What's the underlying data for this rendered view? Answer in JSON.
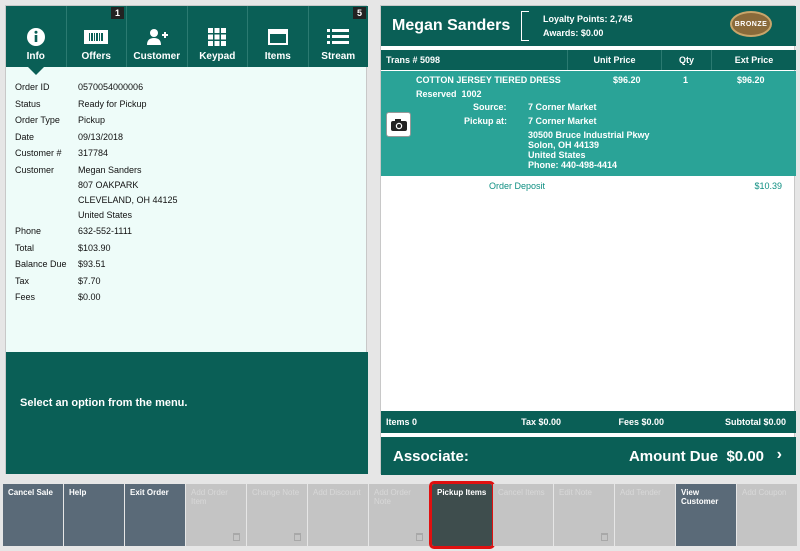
{
  "tabs": [
    {
      "label": "Info",
      "icon": "info-icon",
      "badge": ""
    },
    {
      "label": "Offers",
      "icon": "coupon-icon",
      "badge": "1"
    },
    {
      "label": "Customer",
      "icon": "add-user-icon",
      "badge": ""
    },
    {
      "label": "Keypad",
      "icon": "keypad-icon",
      "badge": ""
    },
    {
      "label": "Items",
      "icon": "items-icon",
      "badge": ""
    },
    {
      "label": "Stream",
      "icon": "stream-icon",
      "badge": "5"
    }
  ],
  "order_info": {
    "order_id_label": "Order ID",
    "order_id": "0570054000006",
    "status_label": "Status",
    "status": "Ready for Pickup",
    "order_type_label": "Order Type",
    "order_type": "Pickup",
    "date_label": "Date",
    "date": "09/13/2018",
    "customer_num_label": "Customer #",
    "customer_num": "317784",
    "customer_label": "Customer",
    "customer_name": "Megan Sanders",
    "address_line1": "807 OAKPARK",
    "address_line2": "CLEVELAND, OH 44125",
    "address_line3": "United States",
    "phone_label": "Phone",
    "phone": "632-552-1111",
    "total_label": "Total",
    "total": "$103.90",
    "balance_label": "Balance Due",
    "balance": "$93.51",
    "tax_label": "Tax",
    "tax": "$7.70",
    "fees_label": "Fees",
    "fees": "$0.00"
  },
  "left_message": "Select an option from the menu.",
  "customer_header": {
    "name": "Megan Sanders",
    "loyalty_points": "Loyalty Points: 2,745",
    "awards": "Awards: $0.00",
    "tier": "BRONZE"
  },
  "columns": {
    "trans": "Trans # 5098",
    "unit": "Unit Price",
    "qty": "Qty",
    "ext": "Ext Price"
  },
  "item": {
    "name": "COTTON JERSEY TIERED DRESS",
    "unit_price": "$96.20",
    "qty": "1",
    "ext_price": "$96.20",
    "reserved": "Reserved  1002",
    "source_label": "Source:",
    "source": "7 Corner Market",
    "pickup_label": "Pickup at:",
    "pickup_name": "7 Corner Market",
    "pickup_addr1": "30500 Bruce Industrial Pkwy",
    "pickup_addr2": "Solon, OH 44139",
    "pickup_addr3": "United States",
    "pickup_phone": "Phone: 440-498-4414"
  },
  "deposit": {
    "label": "Order Deposit",
    "value": "$10.39"
  },
  "totals": {
    "items": "Items 0",
    "tax": "Tax $0.00",
    "fees": "Fees $0.00",
    "subtotal": "Subtotal $0.00"
  },
  "footer": {
    "associate": "Associate:",
    "amount_due": "Amount Due  $0.00"
  },
  "buttons": [
    {
      "label": "Cancel Sale",
      "state": "on"
    },
    {
      "label": "Help",
      "state": "on"
    },
    {
      "label": "Exit Order",
      "state": "on"
    },
    {
      "label": "Add Order Item",
      "state": "off",
      "trash": true
    },
    {
      "label": "Change Note",
      "state": "off",
      "trash": true
    },
    {
      "label": "Add Discount",
      "state": "off",
      "trash": false
    },
    {
      "label": "Add Order Note",
      "state": "off",
      "trash": true
    },
    {
      "label": "Pickup Items",
      "state": "sel",
      "trash": false
    },
    {
      "label": "Cancel Items",
      "state": "off",
      "trash": false
    },
    {
      "label": "Edit Note",
      "state": "off",
      "trash": true
    },
    {
      "label": "Add Tender",
      "state": "off",
      "trash": false
    },
    {
      "label": "View Customer",
      "state": "on"
    },
    {
      "label": "Add Coupon",
      "state": "off",
      "trash": false
    }
  ]
}
